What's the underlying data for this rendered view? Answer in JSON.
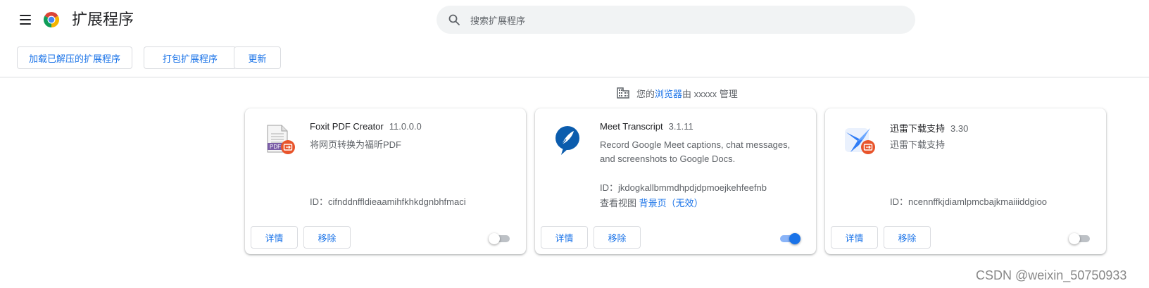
{
  "header": {
    "title": "扩展程序",
    "search_placeholder": "搜索扩展程序"
  },
  "toolbar": {
    "load_unpacked": "加载已解压的扩展程序",
    "pack": "打包扩展程序",
    "update": "更新"
  },
  "managed": {
    "prefix": "您的",
    "link": "浏览器",
    "suffix": "由 xxxxx 管理"
  },
  "extensions": [
    {
      "name": "Foxit PDF Creator",
      "version": "11.0.0.0",
      "description": "将网页转换为福昕PDF",
      "id_label": "ID：cifnddnffldieaamihfkhkdgnbhfmaci",
      "icon_label": "PDF",
      "enabled": false
    },
    {
      "name": "Meet Transcript",
      "version": "3.1.11",
      "description": "Record Google Meet captions, chat messages, and screenshots to Google Docs.",
      "id_label": "ID：jkdogkallbmmdhpdjdpmoejkehfeefnb",
      "views_label": "查看视图",
      "views_link": "背景页",
      "views_status": "（无效）",
      "enabled": true
    },
    {
      "name": "迅雷下载支持",
      "version": "3.30",
      "description": "迅雷下载支持",
      "id_label": "ID：ncennffkjdiamlpmcbajkmaiiiddgioo",
      "enabled": false
    }
  ],
  "card_buttons": {
    "details": "详情",
    "remove": "移除"
  },
  "watermark": "CSDN @weixin_50750933",
  "colors": {
    "accent": "#1a73e8",
    "foxit_badge": "#e8542b",
    "meet_blue": "#0b5cad",
    "xunlei_blue": "#2f7cf6"
  }
}
